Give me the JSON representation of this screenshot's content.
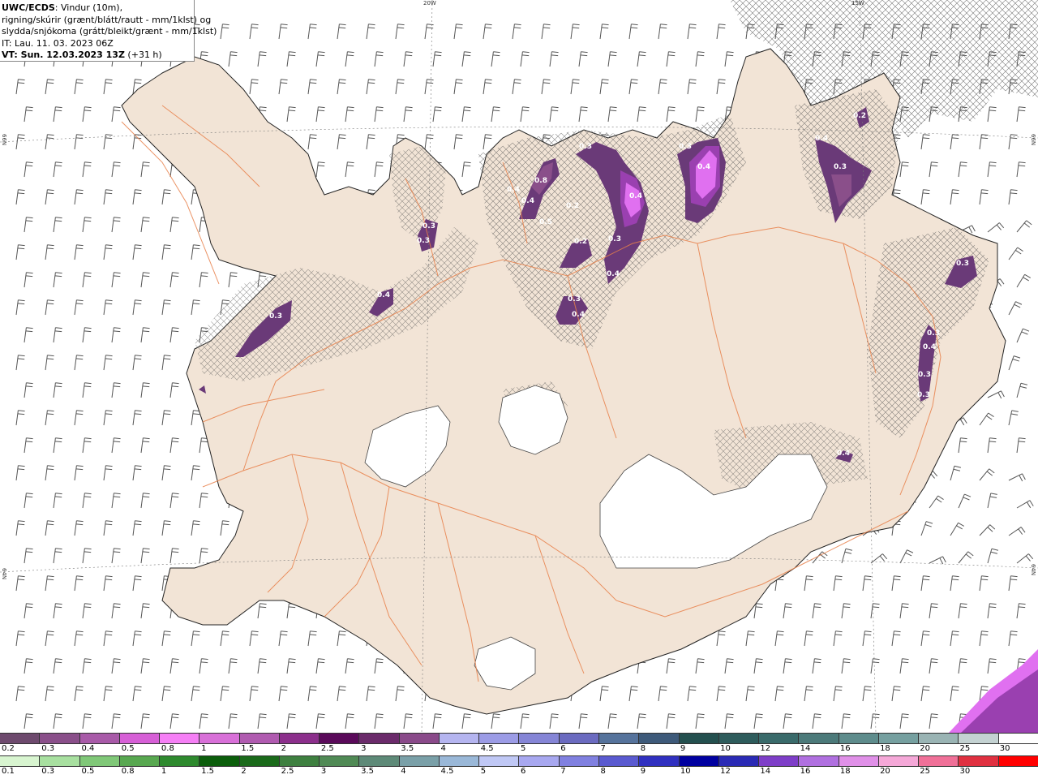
{
  "header": {
    "line1_bold": "UWC/ECDS",
    "line1_rest": ": Vindur (10m),",
    "line2": "rigning/skúrir (grænt/blátt/rautt - mm/1klst) og",
    "line3": "slydda/snjókoma (grátt/bleikt/grænt - mm/1klst)",
    "line4": "IT: Lau. 11. 03. 2023 06Z",
    "line5_bold": "VT: Sun. 12.03.2023 13Z",
    "line5_rest": " (+31 h)"
  },
  "grid_labels": {
    "lon_20w": "20W",
    "lon_15w": "15W",
    "lat_66n_left": "66N",
    "lat_66n_right": "66N",
    "lat_64n_left": "64N",
    "lat_64n_right": "64N"
  },
  "precip_labels": [
    "0.3",
    "0.4",
    "0.3",
    "0.8",
    "0.2",
    "0.3",
    "0.4",
    "0.3",
    "0.4",
    "0.3",
    "0.4",
    "0.3",
    "0.4",
    "0.3",
    "0.4",
    "0.2",
    "0.3",
    "0.3",
    "0.4",
    "0.3",
    "0.3",
    "0.4",
    "0.4",
    "0.5",
    "0.4",
    "0.2",
    "0.3"
  ],
  "snow_scale": {
    "ticks": [
      "0.2",
      "0.3",
      "0.4",
      "0.5",
      "0.8",
      "1",
      "1.5",
      "2",
      "2.5",
      "3",
      "3.5",
      "4",
      "4.5",
      "5",
      "6",
      "7",
      "8",
      "9",
      "10",
      "12",
      "14",
      "16",
      "18",
      "20",
      "25",
      "30"
    ],
    "colors": [
      "#6e4a6e",
      "#8a4f8a",
      "#a85aa8",
      "#d65fd6",
      "#f57ff5",
      "#d870d8",
      "#b05bb0",
      "#8c2f8c",
      "#5a0a5a",
      "#6b2b6b",
      "#8a4a8a",
      "#b5b5f0",
      "#9c9ce6",
      "#8585d6",
      "#6b6bc0",
      "#56739c",
      "#3e5a7a",
      "#24504f",
      "#2e5c5c",
      "#3a6b6b",
      "#4c7a7a",
      "#5e8c8c",
      "#76a0a0",
      "#9ab4b4",
      "#c4d2d2",
      "#ffffff"
    ]
  },
  "rain_scale": {
    "ticks": [
      "0.1",
      "0.3",
      "0.5",
      "0.8",
      "1",
      "1.5",
      "2",
      "2.5",
      "3",
      "3.5",
      "4",
      "4.5",
      "5",
      "6",
      "7",
      "8",
      "9",
      "10",
      "12",
      "14",
      "16",
      "18",
      "20",
      "25",
      "30"
    ],
    "colors": [
      "#d8f5d0",
      "#a8e0a0",
      "#80c878",
      "#58a850",
      "#2e8a2e",
      "#0b5e0b",
      "#1a6a1a",
      "#3e8040",
      "#508a55",
      "#5e8a78",
      "#7aa0a8",
      "#9ab8d8",
      "#c0c8f5",
      "#a8a8f0",
      "#8080e0",
      "#5a5ad0",
      "#3030c0",
      "#0000a0",
      "#2a2ab5",
      "#7e3ec8",
      "#b070e0",
      "#e090e8",
      "#f5a8d8",
      "#f07098",
      "#e03040",
      "#ff0000"
    ]
  },
  "colors": {
    "land": "#f2e4d6",
    "roads": "#e8804a",
    "hatch": "#555555",
    "snow_dark": "#6a3a78",
    "snow_mid": "#9a40b0",
    "snow_bright": "#e070f0"
  }
}
